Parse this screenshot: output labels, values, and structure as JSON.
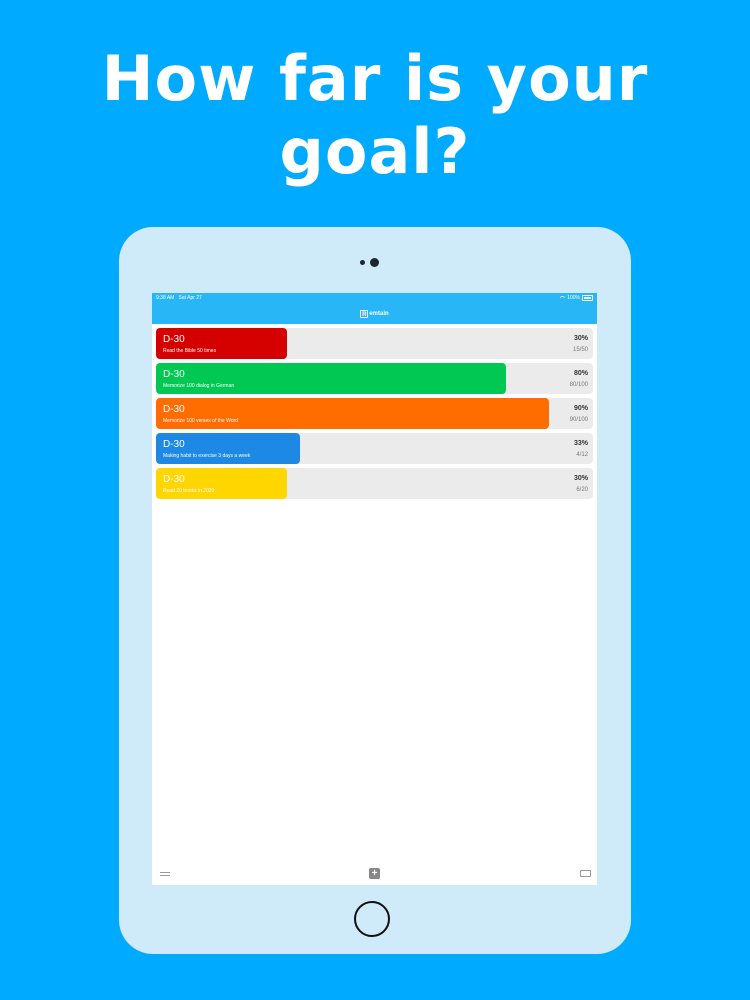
{
  "headline": "How far is your goal?",
  "status_bar": {
    "time": "9:38 AM",
    "date": "Sat Apr 27",
    "battery": "100%"
  },
  "app": {
    "logo_letter": "R",
    "title_rest": "emtain"
  },
  "goals": [
    {
      "dday": "D-30",
      "title": "Read the Bible 50 times",
      "percent": "30%",
      "count": "15/50",
      "progress": 0.3,
      "color": "#d50000"
    },
    {
      "dday": "D-30",
      "title": "Memorize 100 dialog in German",
      "percent": "80%",
      "count": "80/100",
      "progress": 0.8,
      "color": "#00c853"
    },
    {
      "dday": "D-30",
      "title": "Memorize 100 verses of the Word",
      "percent": "90%",
      "count": "90/100",
      "progress": 0.9,
      "color": "#ff6d00"
    },
    {
      "dday": "D-30",
      "title": "Making habit to exercise 3 days a week",
      "percent": "33%",
      "count": "4/12",
      "progress": 0.33,
      "color": "#1e88e5"
    },
    {
      "dday": "D-30",
      "title": "Read 20 books in 2020",
      "percent": "30%",
      "count": "6/20",
      "progress": 0.3,
      "color": "#ffd600"
    }
  ],
  "toolbar": {
    "add_label": "+"
  }
}
